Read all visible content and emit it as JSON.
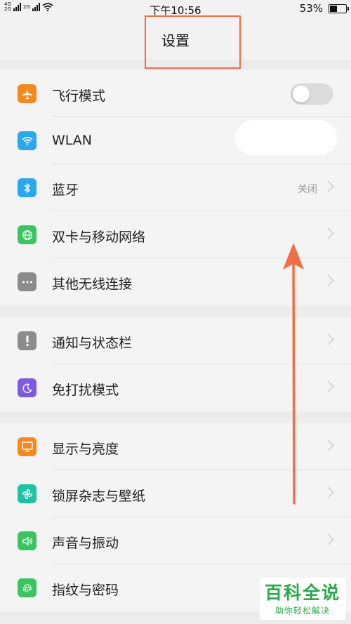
{
  "status_bar": {
    "network_labels": [
      "4G",
      "2G"
    ],
    "network2_label": "2G",
    "time": "下午10:56",
    "battery_percent": "53%",
    "battery_level": 0.53
  },
  "header": {
    "title": "设置"
  },
  "groups": [
    {
      "items": [
        {
          "label": "飞行模式",
          "icon": "airplane-icon",
          "color": "#f5891f",
          "control": "toggle",
          "toggle_on": false
        },
        {
          "label": "WLAN",
          "icon": "wifi-icon",
          "color": "#2aa8ef"
        },
        {
          "label": "蓝牙",
          "icon": "bluetooth-icon",
          "color": "#2aa8ef",
          "status": "关闭"
        },
        {
          "label": "双卡与移动网络",
          "icon": "globe-icon",
          "color": "#3cc462"
        },
        {
          "label": "其他无线连接",
          "icon": "more-dots-icon",
          "color": "#8c8c8c"
        }
      ]
    },
    {
      "items": [
        {
          "label": "通知与状态栏",
          "icon": "exclamation-icon",
          "color": "#8c8c8c"
        },
        {
          "label": "免打扰模式",
          "icon": "moon-icon",
          "color": "#7b5be0"
        }
      ]
    },
    {
      "items": [
        {
          "label": "显示与亮度",
          "icon": "display-icon",
          "color": "#f5891f"
        },
        {
          "label": "锁屏杂志与壁纸",
          "icon": "pinwheel-icon",
          "color": "#1fc3a4"
        },
        {
          "label": "声音与振动",
          "icon": "speaker-icon",
          "color": "#3cc462"
        },
        {
          "label": "指纹与密码",
          "icon": "fingerprint-icon",
          "color": "#3cc462"
        }
      ]
    }
  ],
  "annotation": {
    "color": "#ef6f47"
  },
  "watermark": {
    "title": "百科全说",
    "subtitle": "助你轻松解决"
  }
}
